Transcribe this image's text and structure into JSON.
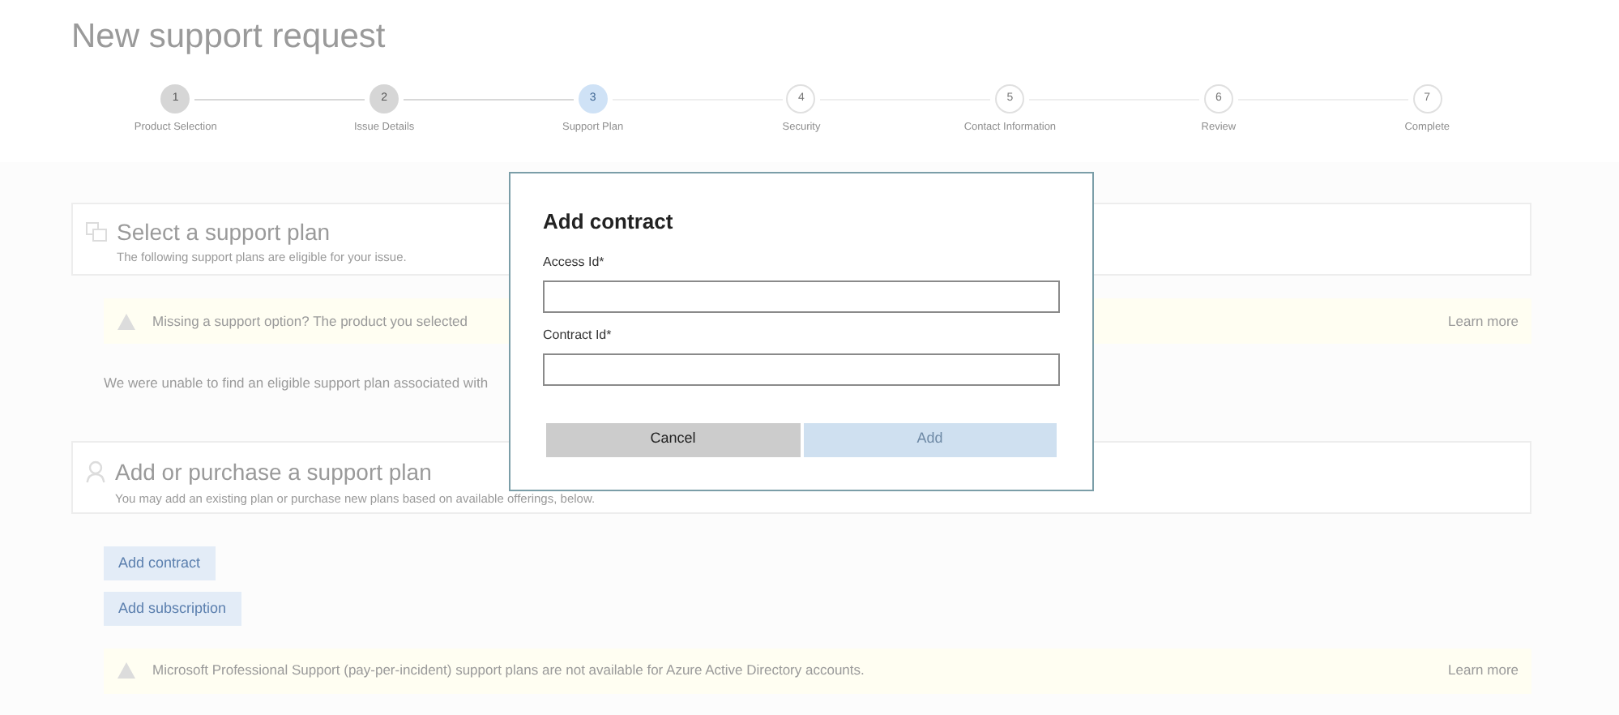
{
  "page": {
    "title": "New support request"
  },
  "steps": [
    {
      "number": "1",
      "label": "Product Selection",
      "completed": true,
      "selected": false
    },
    {
      "number": "2",
      "label": "Issue Details",
      "completed": true,
      "selected": false
    },
    {
      "number": "3",
      "label": "Support Plan",
      "completed": false,
      "selected": true
    },
    {
      "number": "4",
      "label": "Security",
      "completed": false,
      "selected": false
    },
    {
      "number": "5",
      "label": "Contact Information",
      "completed": false,
      "selected": false
    },
    {
      "number": "6",
      "label": "Review",
      "completed": false,
      "selected": false
    },
    {
      "number": "7",
      "label": "Complete",
      "completed": false,
      "selected": false
    }
  ],
  "select_plan": {
    "title": "Select a support plan",
    "subtitle": "The following support plans are eligible for your issue.",
    "warning": {
      "text": "Missing a support option? The product you selected",
      "link": "Learn more"
    },
    "message": "We were unable to find an eligible support plan associated with"
  },
  "add_plan": {
    "title": "Add or purchase a support plan",
    "subtitle": "You may add an existing plan or purchase new plans based on available offerings, below.",
    "buttons": [
      "Add contract",
      "Add subscription"
    ],
    "warning": {
      "text": "Microsoft Professional Support (pay-per-incident) support plans are not available for Azure Active Directory accounts.",
      "link": "Learn more"
    }
  },
  "dialog": {
    "title": "Add contract",
    "fields": [
      {
        "label": "Access Id*"
      },
      {
        "label": "Contract Id*"
      }
    ],
    "buttons": [
      {
        "label": "Cancel",
        "disabled": false
      },
      {
        "label": "Add",
        "disabled": true
      }
    ]
  }
}
